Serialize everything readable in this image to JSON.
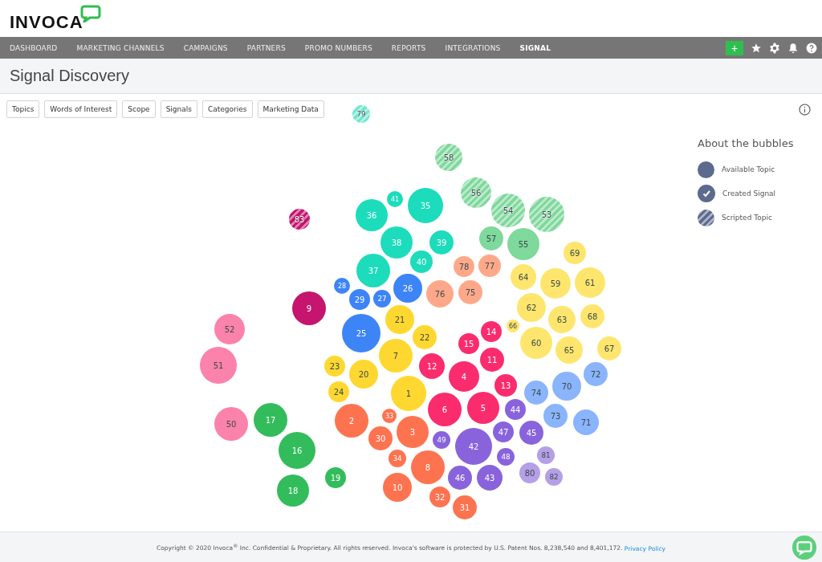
{
  "header": {
    "logo": "INVOCA"
  },
  "nav": {
    "items": [
      {
        "label": "DASHBOARD",
        "selected": false
      },
      {
        "label": "MARKETING CHANNELS",
        "selected": false
      },
      {
        "label": "CAMPAIGNS",
        "selected": false
      },
      {
        "label": "PARTNERS",
        "selected": false
      },
      {
        "label": "PROMO NUMBERS",
        "selected": false
      },
      {
        "label": "REPORTS",
        "selected": false
      },
      {
        "label": "INTEGRATIONS",
        "selected": false
      },
      {
        "label": "SIGNAL",
        "selected": true
      }
    ],
    "add_button": "+"
  },
  "page_title": "Signal Discovery",
  "filters": [
    "Topics",
    "Words of Interest",
    "Scope",
    "Signals",
    "Categories",
    "Marketing Data"
  ],
  "legend": {
    "title": "About the bubbles",
    "items": [
      {
        "label": "Available Topic",
        "kind": "available"
      },
      {
        "label": "Created Signal",
        "kind": "created"
      },
      {
        "label": "Scripted Topic",
        "kind": "scripted"
      }
    ]
  },
  "bubbles": [
    {
      "label": "79",
      "color": "#6ee6d0",
      "kind": "scripted"
    },
    {
      "label": "58",
      "color": "#7fd89c",
      "kind": "scripted"
    },
    {
      "label": "83",
      "color": "#c5156e",
      "kind": "scripted"
    },
    {
      "label": "36",
      "color": "#1cdcbc",
      "kind": "available"
    },
    {
      "label": "41",
      "color": "#1cdcbc",
      "kind": "available"
    },
    {
      "label": "35",
      "color": "#1cdcbc",
      "kind": "available"
    },
    {
      "label": "56",
      "color": "#7fd89c",
      "kind": "scripted"
    },
    {
      "label": "54",
      "color": "#7fd89c",
      "kind": "scripted"
    },
    {
      "label": "53",
      "color": "#7fd89c",
      "kind": "scripted"
    },
    {
      "label": "38",
      "color": "#1cdcbc",
      "kind": "available"
    },
    {
      "label": "39",
      "color": "#1cdcbc",
      "kind": "available"
    },
    {
      "label": "57",
      "color": "#7fd89c",
      "kind": "available"
    },
    {
      "label": "55",
      "color": "#7fd89c",
      "kind": "available"
    },
    {
      "label": "69",
      "color": "#fee66e",
      "kind": "available"
    },
    {
      "label": "37",
      "color": "#1cdcbc",
      "kind": "available"
    },
    {
      "label": "40",
      "color": "#1cdcbc",
      "kind": "available"
    },
    {
      "label": "78",
      "color": "#fea88a",
      "kind": "available"
    },
    {
      "label": "77",
      "color": "#fea88a",
      "kind": "available"
    },
    {
      "label": "28",
      "color": "#3d84f7",
      "kind": "available"
    },
    {
      "label": "29",
      "color": "#3d84f7",
      "kind": "available"
    },
    {
      "label": "27",
      "color": "#3d84f7",
      "kind": "available"
    },
    {
      "label": "26",
      "color": "#3d84f7",
      "kind": "available"
    },
    {
      "label": "76",
      "color": "#fea88a",
      "kind": "available"
    },
    {
      "label": "75",
      "color": "#fea88a",
      "kind": "available"
    },
    {
      "label": "64",
      "color": "#fee66e",
      "kind": "available"
    },
    {
      "label": "59",
      "color": "#fee66e",
      "kind": "available"
    },
    {
      "label": "61",
      "color": "#fee66e",
      "kind": "available"
    },
    {
      "label": "52",
      "color": "#fb82ab",
      "kind": "available"
    },
    {
      "label": "9",
      "color": "#c5156e",
      "kind": "available"
    },
    {
      "label": "25",
      "color": "#3d84f7",
      "kind": "available"
    },
    {
      "label": "21",
      "color": "#fed830",
      "kind": "available"
    },
    {
      "label": "22",
      "color": "#fed830",
      "kind": "available"
    },
    {
      "label": "14",
      "color": "#fa2c6e",
      "kind": "available"
    },
    {
      "label": "66",
      "color": "#fee66e",
      "kind": "available"
    },
    {
      "label": "62",
      "color": "#fee66e",
      "kind": "available"
    },
    {
      "label": "63",
      "color": "#fee66e",
      "kind": "available"
    },
    {
      "label": "68",
      "color": "#fee66e",
      "kind": "available"
    },
    {
      "label": "15",
      "color": "#fa2c6e",
      "kind": "available"
    },
    {
      "label": "60",
      "color": "#fee66e",
      "kind": "available"
    },
    {
      "label": "65",
      "color": "#fee66e",
      "kind": "available"
    },
    {
      "label": "67",
      "color": "#fee66e",
      "kind": "available"
    },
    {
      "label": "51",
      "color": "#fb82ab",
      "kind": "available"
    },
    {
      "label": "23",
      "color": "#fed830",
      "kind": "available"
    },
    {
      "label": "20",
      "color": "#fed830",
      "kind": "available"
    },
    {
      "label": "7",
      "color": "#fed830",
      "kind": "available"
    },
    {
      "label": "12",
      "color": "#fa2c6e",
      "kind": "available"
    },
    {
      "label": "4",
      "color": "#fa2c6e",
      "kind": "available"
    },
    {
      "label": "11",
      "color": "#fa2c6e",
      "kind": "available"
    },
    {
      "label": "72",
      "color": "#8ab4fb",
      "kind": "available"
    },
    {
      "label": "24",
      "color": "#fed830",
      "kind": "available"
    },
    {
      "label": "1",
      "color": "#fed830",
      "kind": "available"
    },
    {
      "label": "13",
      "color": "#fa2c6e",
      "kind": "available"
    },
    {
      "label": "74",
      "color": "#8ab4fb",
      "kind": "available"
    },
    {
      "label": "70",
      "color": "#8ab4fb",
      "kind": "available"
    },
    {
      "label": "50",
      "color": "#fb82ab",
      "kind": "available"
    },
    {
      "label": "17",
      "color": "#33bc5b",
      "kind": "available"
    },
    {
      "label": "2",
      "color": "#fd7350",
      "kind": "available"
    },
    {
      "label": "33",
      "color": "#fd7350",
      "kind": "available"
    },
    {
      "label": "6",
      "color": "#fa2c6e",
      "kind": "available"
    },
    {
      "label": "5",
      "color": "#fa2c6e",
      "kind": "available"
    },
    {
      "label": "44",
      "color": "#8963dc",
      "kind": "available"
    },
    {
      "label": "73",
      "color": "#8ab4fb",
      "kind": "available"
    },
    {
      "label": "71",
      "color": "#8ab4fb",
      "kind": "available"
    },
    {
      "label": "30",
      "color": "#fd7350",
      "kind": "available"
    },
    {
      "label": "3",
      "color": "#fd7350",
      "kind": "available"
    },
    {
      "label": "49",
      "color": "#8963dc",
      "kind": "available"
    },
    {
      "label": "47",
      "color": "#8963dc",
      "kind": "available"
    },
    {
      "label": "45",
      "color": "#8963dc",
      "kind": "available"
    },
    {
      "label": "16",
      "color": "#33bc5b",
      "kind": "available"
    },
    {
      "label": "42",
      "color": "#8963dc",
      "kind": "available"
    },
    {
      "label": "34",
      "color": "#fd7350",
      "kind": "available"
    },
    {
      "label": "48",
      "color": "#8963dc",
      "kind": "available"
    },
    {
      "label": "81",
      "color": "#b59fe6",
      "kind": "available"
    },
    {
      "label": "19",
      "color": "#33bc5b",
      "kind": "available"
    },
    {
      "label": "8",
      "color": "#fd7350",
      "kind": "available"
    },
    {
      "label": "46",
      "color": "#8963dc",
      "kind": "available"
    },
    {
      "label": "43",
      "color": "#8963dc",
      "kind": "available"
    },
    {
      "label": "80",
      "color": "#b59fe6",
      "kind": "available"
    },
    {
      "label": "82",
      "color": "#b59fe6",
      "kind": "available"
    },
    {
      "label": "18",
      "color": "#33bc5b",
      "kind": "available"
    },
    {
      "label": "10",
      "color": "#fd7350",
      "kind": "available"
    },
    {
      "label": "32",
      "color": "#fd7350",
      "kind": "available"
    },
    {
      "label": "31",
      "color": "#fd7350",
      "kind": "available"
    }
  ],
  "footer": {
    "text": "Copyright © 2020 Invoca$^{®}$ Inc. Confidential & Proprietary. All rights reserved. Invoca's software is protected by U.S. Patent Nos. 8,238,540 and 8,401,172.",
    "link": "Privacy Policy"
  }
}
